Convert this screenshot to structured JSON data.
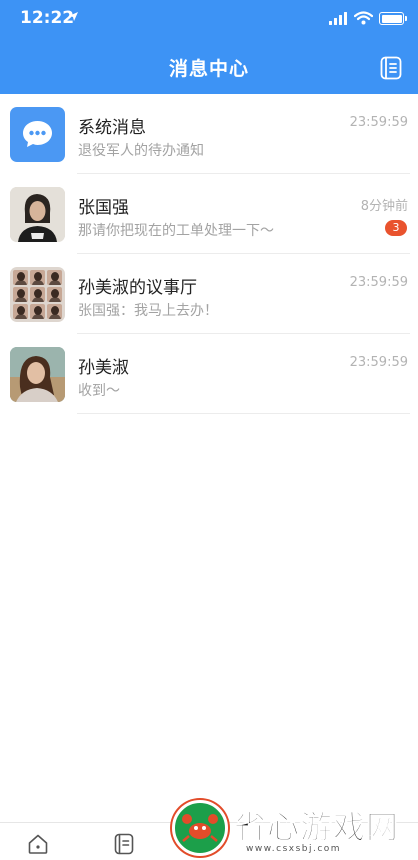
{
  "status_bar": {
    "time": "12:22"
  },
  "header": {
    "title": "消息中心",
    "background_color": "#3d93f5",
    "right_icon": "document-list-icon"
  },
  "messages": [
    {
      "title": "系统消息",
      "subtitle": "退役军人的待办通知",
      "time": "23:59:59",
      "avatar": "chat-bubble-icon"
    },
    {
      "title": "张国强",
      "subtitle": "那请你把现在的工单处理一下～",
      "time": "8分钟前",
      "unread": "3",
      "avatar": "person-photo"
    },
    {
      "title": "孙美淑的议事厅",
      "subtitle": "张国强：我马上去办！",
      "time": "23:59:59",
      "avatar": "group-photo-grid"
    },
    {
      "title": "孙美淑",
      "subtitle": "收到～",
      "time": "23:59:59",
      "avatar": "person-photo"
    }
  ],
  "tabbar": {
    "icons": [
      "home-icon",
      "document-icon"
    ]
  },
  "watermark": {
    "text": "省心游戏网",
    "url": "www.csxsbj.com"
  },
  "colors": {
    "accent": "#3d93f5",
    "badge": "#e9532e"
  }
}
